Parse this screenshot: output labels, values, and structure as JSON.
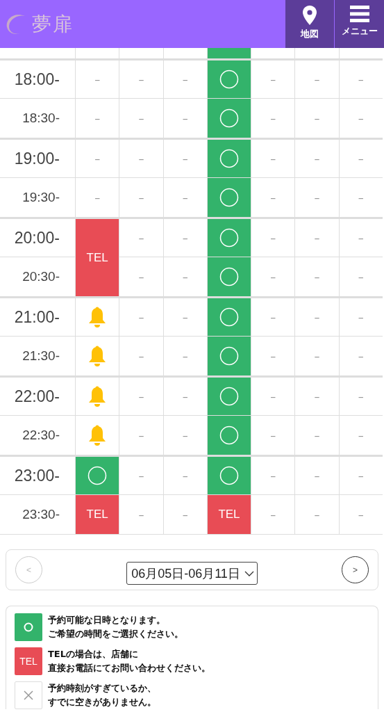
{
  "header": {
    "logo": "夢扉",
    "buttons": [
      {
        "kind": "map",
        "label": "地図"
      },
      {
        "kind": "menu",
        "label": "メニュー"
      }
    ]
  },
  "schedule": {
    "top_partial_row": {
      "cells": [
        {
          "kind": "blank"
        },
        {
          "kind": "blank"
        },
        {
          "kind": "blank"
        },
        {
          "kind": "open"
        },
        {
          "kind": "blank"
        },
        {
          "kind": "blank"
        },
        {
          "kind": "blank"
        }
      ]
    },
    "rows": [
      {
        "time": "18:00-",
        "kind": "hour",
        "cells": [
          {
            "kind": "dash",
            "text": "–"
          },
          {
            "kind": "dash",
            "text": "–"
          },
          {
            "kind": "dash",
            "text": "–"
          },
          {
            "kind": "open"
          },
          {
            "kind": "dash",
            "text": "–"
          },
          {
            "kind": "dash",
            "text": "–"
          },
          {
            "kind": "dash",
            "text": "–"
          }
        ]
      },
      {
        "time": "18:30-",
        "kind": "half",
        "cells": [
          {
            "kind": "dash",
            "text": "–"
          },
          {
            "kind": "dash",
            "text": "–"
          },
          {
            "kind": "dash",
            "text": "–"
          },
          {
            "kind": "open"
          },
          {
            "kind": "dash",
            "text": "–"
          },
          {
            "kind": "dash",
            "text": "–"
          },
          {
            "kind": "dash",
            "text": "–"
          }
        ]
      },
      {
        "time": "19:00-",
        "kind": "hour",
        "cells": [
          {
            "kind": "dash",
            "text": "–"
          },
          {
            "kind": "dash",
            "text": "–"
          },
          {
            "kind": "dash",
            "text": "–"
          },
          {
            "kind": "open"
          },
          {
            "kind": "dash",
            "text": "–"
          },
          {
            "kind": "dash",
            "text": "–"
          },
          {
            "kind": "dash",
            "text": "–"
          }
        ]
      },
      {
        "time": "19:30-",
        "kind": "half",
        "cells": [
          {
            "kind": "dash",
            "text": "–"
          },
          {
            "kind": "dash",
            "text": "–"
          },
          {
            "kind": "dash",
            "text": "–"
          },
          {
            "kind": "open"
          },
          {
            "kind": "dash",
            "text": "–"
          },
          {
            "kind": "dash",
            "text": "–"
          },
          {
            "kind": "dash",
            "text": "–"
          }
        ]
      },
      {
        "time": "20:00-",
        "kind": "hour",
        "cells": [
          {
            "kind": "tel",
            "text": "TEL"
          },
          {
            "kind": "dash",
            "text": "–"
          },
          {
            "kind": "dash",
            "text": "–"
          },
          {
            "kind": "open"
          },
          {
            "kind": "dash",
            "text": "–"
          },
          {
            "kind": "dash",
            "text": "–"
          },
          {
            "kind": "dash",
            "text": "–"
          }
        ]
      },
      {
        "time": "20:30-",
        "kind": "half",
        "cells": [
          {
            "kind": "covered"
          },
          {
            "kind": "dash",
            "text": "–"
          },
          {
            "kind": "dash",
            "text": "–"
          },
          {
            "kind": "open"
          },
          {
            "kind": "dash",
            "text": "–"
          },
          {
            "kind": "dash",
            "text": "–"
          },
          {
            "kind": "dash",
            "text": "–"
          }
        ]
      },
      {
        "time": "21:00-",
        "kind": "hour",
        "cells": [
          {
            "kind": "bell"
          },
          {
            "kind": "dash",
            "text": "–"
          },
          {
            "kind": "dash",
            "text": "–"
          },
          {
            "kind": "open"
          },
          {
            "kind": "dash",
            "text": "–"
          },
          {
            "kind": "dash",
            "text": "–"
          },
          {
            "kind": "dash",
            "text": "–"
          }
        ]
      },
      {
        "time": "21:30-",
        "kind": "half",
        "cells": [
          {
            "kind": "bell"
          },
          {
            "kind": "dash",
            "text": "–"
          },
          {
            "kind": "dash",
            "text": "–"
          },
          {
            "kind": "open"
          },
          {
            "kind": "dash",
            "text": "–"
          },
          {
            "kind": "dash",
            "text": "–"
          },
          {
            "kind": "dash",
            "text": "–"
          }
        ]
      },
      {
        "time": "22:00-",
        "kind": "hour",
        "cells": [
          {
            "kind": "bell"
          },
          {
            "kind": "dash",
            "text": "–"
          },
          {
            "kind": "dash",
            "text": "–"
          },
          {
            "kind": "open"
          },
          {
            "kind": "dash",
            "text": "–"
          },
          {
            "kind": "dash",
            "text": "–"
          },
          {
            "kind": "dash",
            "text": "–"
          }
        ]
      },
      {
        "time": "22:30-",
        "kind": "half",
        "cells": [
          {
            "kind": "bell"
          },
          {
            "kind": "dash",
            "text": "–"
          },
          {
            "kind": "dash",
            "text": "–"
          },
          {
            "kind": "open"
          },
          {
            "kind": "dash",
            "text": "–"
          },
          {
            "kind": "dash",
            "text": "–"
          },
          {
            "kind": "dash",
            "text": "–"
          }
        ]
      },
      {
        "time": "23:00-",
        "kind": "hour",
        "cells": [
          {
            "kind": "open"
          },
          {
            "kind": "dash",
            "text": "–"
          },
          {
            "kind": "dash",
            "text": "–"
          },
          {
            "kind": "open"
          },
          {
            "kind": "dash",
            "text": "–"
          },
          {
            "kind": "dash",
            "text": "–"
          },
          {
            "kind": "dash",
            "text": "–"
          }
        ]
      },
      {
        "time": "23:30-",
        "kind": "half",
        "cells": [
          {
            "kind": "tel",
            "text": "TEL"
          },
          {
            "kind": "dash",
            "text": "–"
          },
          {
            "kind": "dash",
            "text": "–"
          },
          {
            "kind": "tel",
            "text": "TEL"
          },
          {
            "kind": "dash",
            "text": "–"
          },
          {
            "kind": "dash",
            "text": "–"
          },
          {
            "kind": "dash",
            "text": "–"
          }
        ]
      }
    ]
  },
  "pager": {
    "prev": {
      "label": "<",
      "disabled": true
    },
    "week": "06月05日-06月11日",
    "next": {
      "label": ">",
      "disabled": false
    }
  },
  "legend": [
    {
      "kind": "open",
      "lines": [
        "予約可能な日時となります。",
        "ご希望の時間をご選択ください。"
      ]
    },
    {
      "kind": "tel",
      "badge": "TEL",
      "lines": [
        "TELの場合は、店舗に",
        "直接お電話にてお問い合わせください。"
      ]
    },
    {
      "kind": "closed",
      "lines": [
        "予約時刻がすぎているか、",
        "すでに空きがありません。"
      ]
    }
  ]
}
